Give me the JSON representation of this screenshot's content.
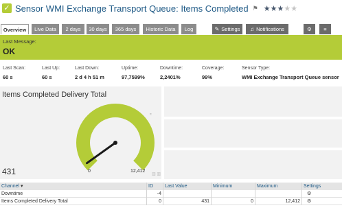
{
  "header": {
    "title": "Sensor WMI Exchange Transport Queue: Items Completed",
    "priority_stars_filled": 3,
    "priority_stars_total": 5
  },
  "tabs": [
    {
      "label": "Overview"
    },
    {
      "label": "Live Data"
    },
    {
      "label": "2 days"
    },
    {
      "label": "30 days"
    },
    {
      "label": "365 days"
    },
    {
      "label": "Historic Data"
    },
    {
      "label": "Log"
    },
    {
      "label": "Settings"
    },
    {
      "label": "Notifications"
    }
  ],
  "status": {
    "label": "Last Message:",
    "value": "OK",
    "color": "#b4cc38"
  },
  "stats": [
    {
      "label": "Last Scan:",
      "value": "60 s"
    },
    {
      "label": "Last Up:",
      "value": "60 s"
    },
    {
      "label": "Last Down:",
      "value": "2 d 4 h 51 m"
    },
    {
      "label": "Uptime:",
      "value": "97,7599%"
    },
    {
      "label": "Downtime:",
      "value": "2,2401%"
    },
    {
      "label": "Coverage:",
      "value": "99%"
    },
    {
      "label": "Sensor Type:",
      "value": "WMI Exchange Transport Queue sensor"
    }
  ],
  "gauge": {
    "title": "Items Completed Delivery Total",
    "value_label": "431",
    "min_label": "0",
    "max_label": "12,412",
    "value": 431,
    "min": 0,
    "max": 12412,
    "color": "#b4cc38"
  },
  "table": {
    "headers": {
      "channel": "Channel",
      "id": "ID",
      "last_value": "Last Value",
      "minimum": "Minimum",
      "maximum": "Maximum",
      "settings": "Settings"
    },
    "rows": [
      {
        "channel": "Downtime",
        "id": "-4",
        "last_value": "",
        "minimum": "",
        "maximum": ""
      },
      {
        "channel": "Items Completed Delivery Total",
        "id": "0",
        "last_value": "431",
        "minimum": "0",
        "maximum": "12,412"
      }
    ]
  }
}
